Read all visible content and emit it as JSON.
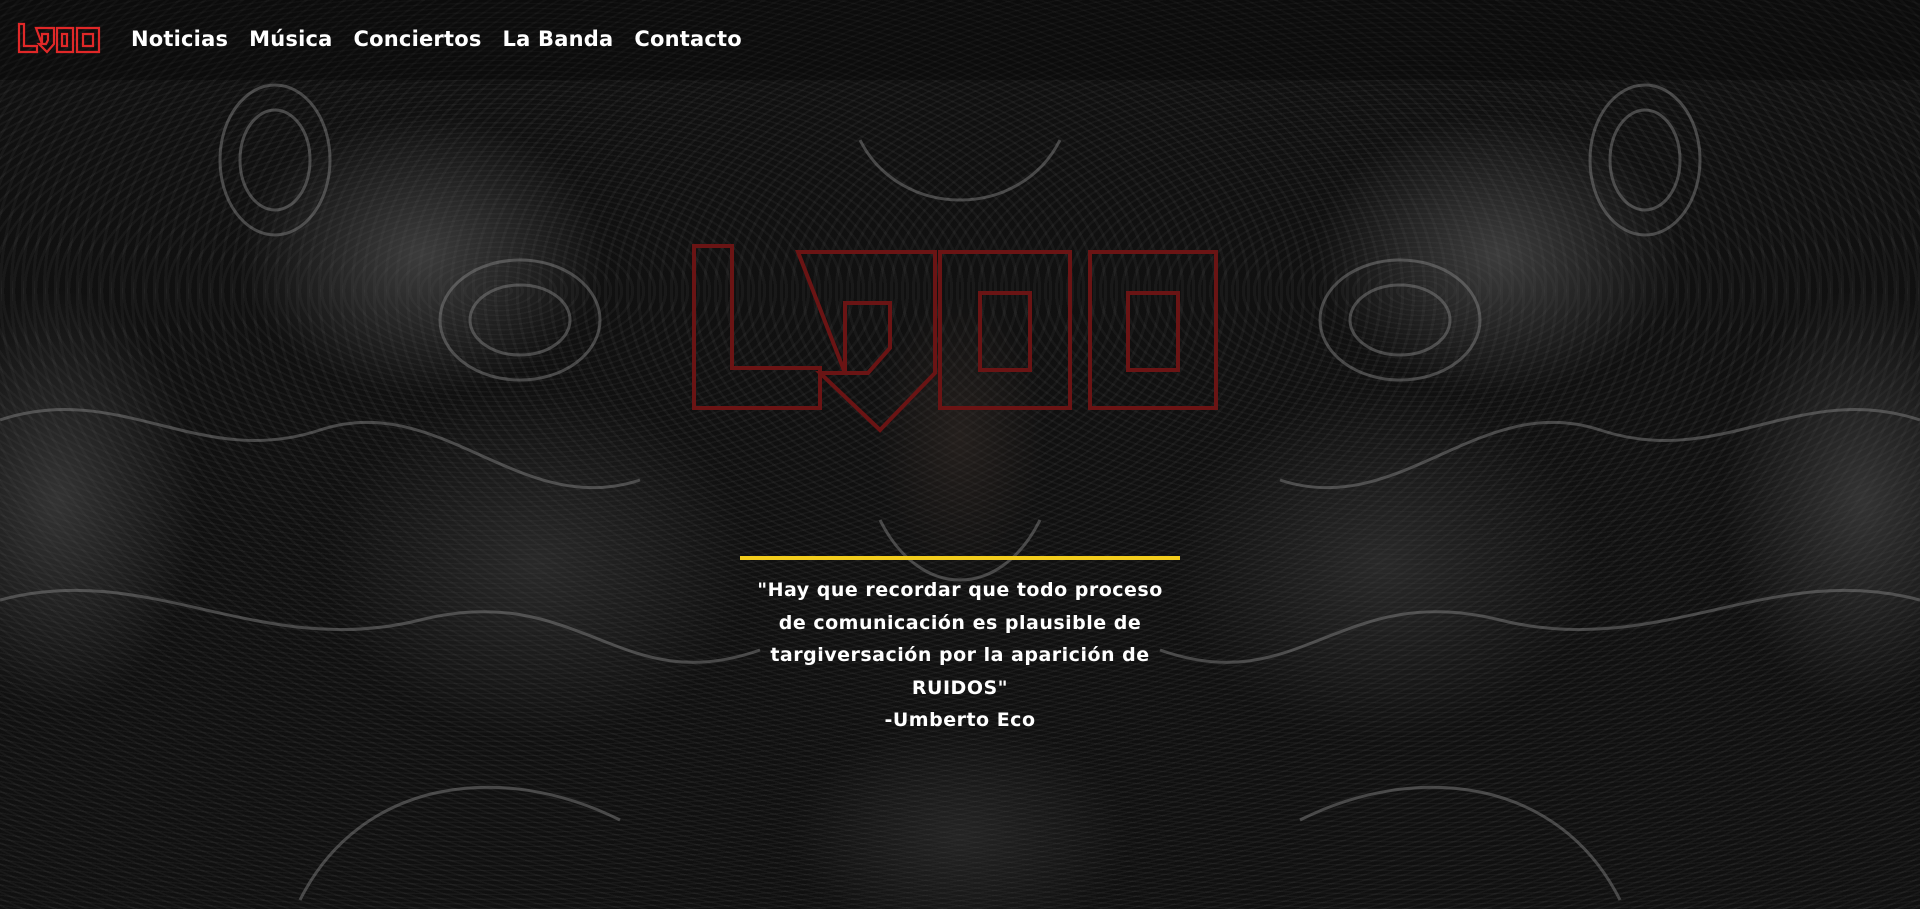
{
  "brand": {
    "logo_text": "LRDO",
    "accent_color": "#e02828",
    "hero_logo_color": "#6a1414"
  },
  "nav": {
    "items": [
      {
        "label": "Noticias"
      },
      {
        "label": "Música"
      },
      {
        "label": "Conciertos"
      },
      {
        "label": "La Banda"
      },
      {
        "label": "Contacto"
      }
    ]
  },
  "hero": {
    "quote": "\"Hay que recordar que todo proceso de comunicación es plausible de targiversación por la aparición de RUIDOS\"",
    "author": "-Umberto Eco",
    "divider_color": "#f2cc1c"
  }
}
